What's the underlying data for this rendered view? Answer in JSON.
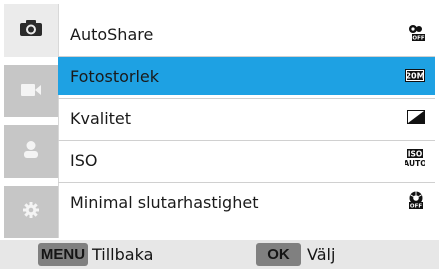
{
  "tabs": [
    {
      "icon": "camera-icon",
      "active": true
    },
    {
      "icon": "video-camera-icon",
      "active": false
    },
    {
      "icon": "person-icon",
      "active": false
    },
    {
      "icon": "gear-icon",
      "active": false
    }
  ],
  "menu": {
    "items": [
      {
        "label": "AutoShare",
        "value_icon": "autoshare-off-icon",
        "selected": false
      },
      {
        "label": "Fotostorlek",
        "value_icon": "photo-size-20m-icon",
        "value_text": "20M",
        "selected": true
      },
      {
        "label": "Kvalitet",
        "value_icon": "quality-icon",
        "selected": false
      },
      {
        "label": "ISO",
        "value_icon": "iso-auto-icon",
        "value_text": [
          "ISO",
          "AUTO"
        ],
        "selected": false
      },
      {
        "label": "Minimal slutarhastighet",
        "value_icon": "min-shutter-off-icon",
        "selected": false
      }
    ],
    "selected_color": "#1ea1e3"
  },
  "bottom_bar": {
    "menu_key": "MENU",
    "menu_action": "Tillbaka",
    "ok_key": "OK",
    "ok_action": "Välj"
  }
}
